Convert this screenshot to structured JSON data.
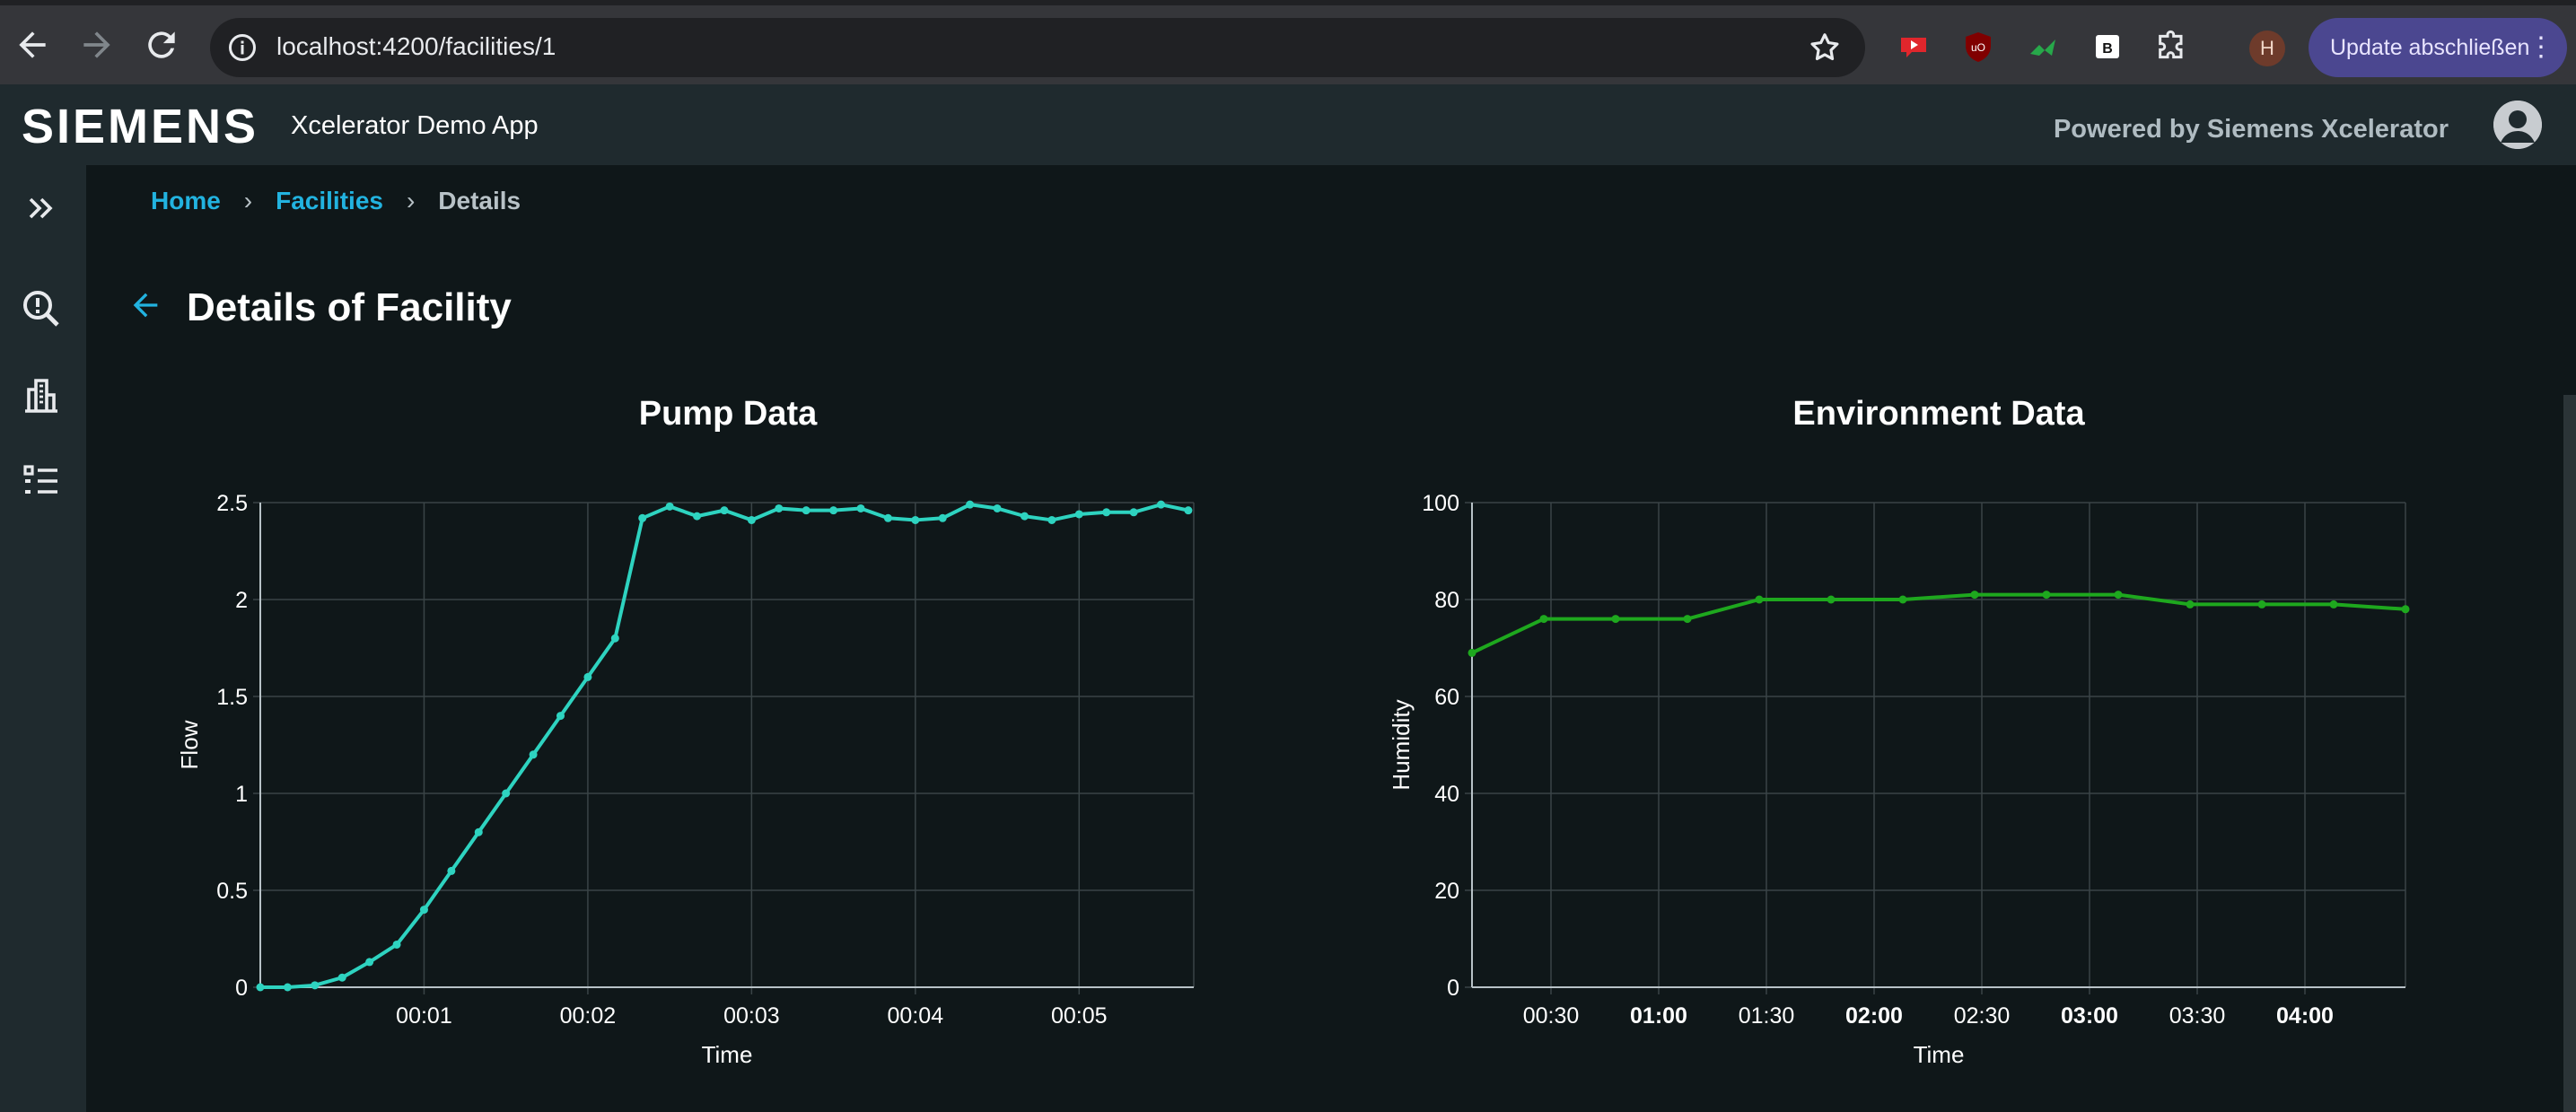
{
  "browser": {
    "url": "localhost:4200/facilities/1",
    "profile_initial": "H",
    "update_label": "Update abschließen"
  },
  "app": {
    "logo": "SIEMENS",
    "name": "Xcelerator Demo App",
    "powered_by": "Powered by Siemens Xcelerator"
  },
  "sidebar": {
    "items": [
      {
        "icon": "double-chevron-right-icon"
      },
      {
        "icon": "search-alert-icon"
      },
      {
        "icon": "building-icon"
      },
      {
        "icon": "list-icon"
      }
    ]
  },
  "breadcrumb": {
    "home": "Home",
    "facilities": "Facilities",
    "current": "Details",
    "separator": "›"
  },
  "page": {
    "title": "Details of Facility"
  },
  "colors": {
    "accent": "#22b3e0",
    "pump_line": "#2ed3c0",
    "env_line": "#1ea81e",
    "background": "#0f1719"
  },
  "chart_data": [
    {
      "type": "line",
      "title": "Pump Data",
      "xlabel": "Time",
      "ylabel": "Flow",
      "xlim_seconds": [
        0,
        342
      ],
      "x_ticks": [
        "00:01",
        "00:02",
        "00:03",
        "00:04",
        "00:05"
      ],
      "x_tick_seconds": [
        60,
        120,
        180,
        240,
        300
      ],
      "ylim": [
        0,
        2.5
      ],
      "y_ticks": [
        "0",
        "0.5",
        "1",
        "1.5",
        "2",
        "2.5"
      ],
      "grid": true,
      "series": [
        {
          "color": "#2ed3c0",
          "x_seconds": [
            0,
            10,
            20,
            30,
            40,
            50,
            60,
            70,
            80,
            90,
            100,
            110,
            120,
            130,
            140,
            150,
            160,
            170,
            180,
            190,
            200,
            210,
            220,
            230,
            240,
            250,
            260,
            270,
            280,
            290,
            300,
            310,
            320,
            330,
            340
          ],
          "values": [
            0,
            0,
            0.01,
            0.05,
            0.13,
            0.22,
            0.4,
            0.6,
            0.8,
            1.0,
            1.2,
            1.4,
            1.6,
            1.8,
            2.42,
            2.48,
            2.43,
            2.46,
            2.41,
            2.47,
            2.46,
            2.46,
            2.47,
            2.42,
            2.41,
            2.42,
            2.49,
            2.47,
            2.43,
            2.41,
            2.44,
            2.45,
            2.45,
            2.49,
            2.46
          ]
        }
      ]
    },
    {
      "type": "line",
      "title": "Environment Data",
      "xlabel": "Time",
      "ylabel": "Humidity",
      "xlim_minutes": [
        8,
        268
      ],
      "x_ticks": [
        "00:30",
        "01:00",
        "01:30",
        "02:00",
        "02:30",
        "03:00",
        "03:30",
        "04:00"
      ],
      "x_tick_minutes": [
        30,
        60,
        90,
        120,
        150,
        180,
        210,
        240
      ],
      "x_tick_bold": [
        false,
        true,
        false,
        true,
        false,
        true,
        false,
        true
      ],
      "ylim": [
        0,
        100
      ],
      "y_ticks": [
        "0",
        "20",
        "40",
        "60",
        "80",
        "100"
      ],
      "grid": true,
      "series": [
        {
          "color": "#1ea81e",
          "x_minutes": [
            8,
            28,
            48,
            68,
            88,
            108,
            128,
            148,
            168,
            188,
            208,
            228,
            248,
            268
          ],
          "values": [
            69,
            76,
            76,
            76,
            80,
            80,
            80,
            81,
            81,
            81,
            79,
            79,
            79,
            78
          ]
        }
      ]
    }
  ]
}
